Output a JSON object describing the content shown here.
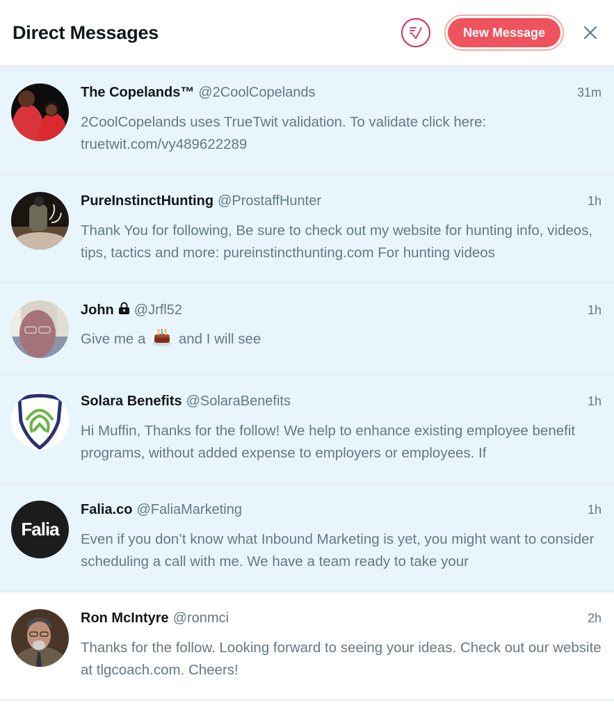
{
  "header": {
    "title": "Direct Messages",
    "mark_all_read_icon": "mark-all-read-icon",
    "new_message_label": "New Message",
    "close_icon": "close-icon"
  },
  "colors": {
    "accent": "#ef535d",
    "unread_bg": "#e8f5fd",
    "divider": "#e6ecf0",
    "secondary_text": "#657786"
  },
  "conversations": [
    {
      "name": "The Copelands™",
      "handle": "@2CoolCopelands",
      "time": "31m",
      "message": "2CoolCopelands uses TrueTwit validation. To validate click here: truetwit.com/vy489622289",
      "unread": true
    },
    {
      "name": "PureInstinctHunting",
      "handle": "@ProstaffHunter",
      "time": "1h",
      "message": "Thank You for following, Be sure to check out my website for hunting info, videos, tips, tactics and more: pureinstincthunting.com For hunting videos",
      "unread": true
    },
    {
      "name": "John",
      "handle": "@Jrfl52",
      "time": "1h",
      "protected": true,
      "message_before": "Give me a",
      "message_emoji": "birthday-cake",
      "message_after": "and I will see",
      "unread": true
    },
    {
      "name": "Solara Benefits",
      "handle": "@SolaraBenefits",
      "time": "1h",
      "message": "Hi Muffin, Thanks for the follow! We help to enhance existing employee benefit programs, without added expense to employers or employees. If",
      "unread": true
    },
    {
      "name": "Falia.co",
      "handle": "@FaliaMarketing",
      "time": "1h",
      "avatar_text": "Falia",
      "message": "Even if you don’t know what Inbound Marketing is yet, you might want to consider scheduling a call with me. We have a team ready to take your",
      "unread": true
    },
    {
      "name": "Ron McIntyre",
      "handle": "@ronmci",
      "time": "2h",
      "message": "Thanks for the follow. Looking forward to seeing your ideas. Check out our website at tlgcoach.com. Cheers!",
      "unread": false
    }
  ]
}
